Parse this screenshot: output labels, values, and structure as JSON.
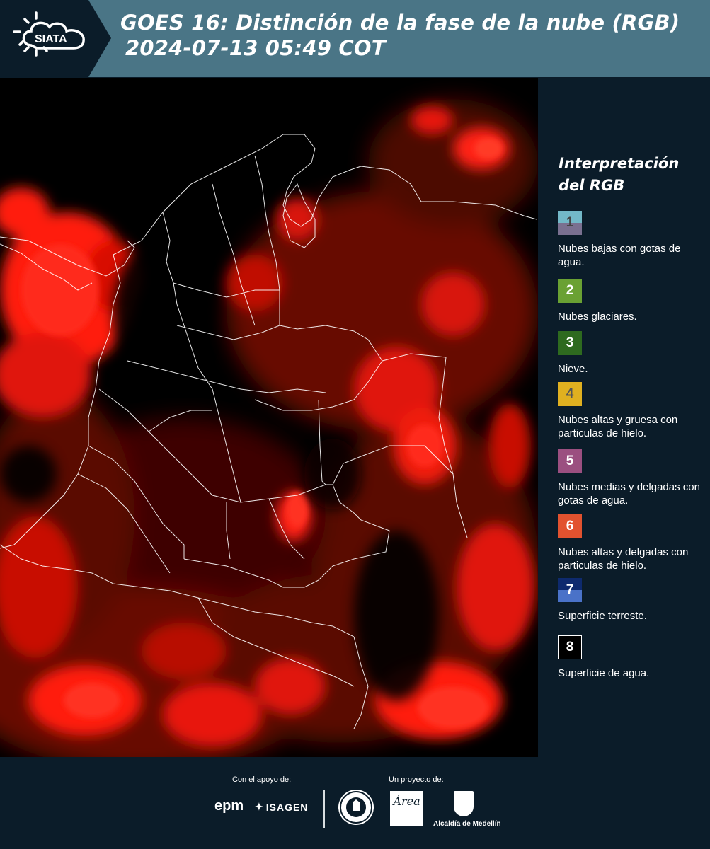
{
  "header": {
    "title_line1": "GOES 16: Distinción de la fase de la nube (RGB)",
    "title_line2": "2024-07-13 05:49 COT",
    "logo_text": "SIATA"
  },
  "legend": {
    "title_line1": "Interpretación",
    "title_line2": "del RGB",
    "items": [
      {
        "num": "1",
        "label": "Nubes bajas con gotas de agua.",
        "color_top": "#73b8c8",
        "color_bottom": "#7a7090",
        "num_color": "#444444"
      },
      {
        "num": "2",
        "label": "Nubes glaciares.",
        "color_top": "#6aa133",
        "color_bottom": "#6aa133",
        "num_color": "#ffffff"
      },
      {
        "num": "3",
        "label": "Nieve.",
        "color_top": "#2e6a1f",
        "color_bottom": "#2e6a1f",
        "num_color": "#ffffff"
      },
      {
        "num": "4",
        "label": "Nubes altas y gruesa con particulas de hielo.",
        "color_top": "#e0b020",
        "color_bottom": "#e0b020",
        "num_color": "#555555"
      },
      {
        "num": "5",
        "label": "Nubes medias y delgadas con gotas de agua.",
        "color_top": "#9b4f80",
        "color_bottom": "#9b4f80",
        "num_color": "#ffffff"
      },
      {
        "num": "6",
        "label": "Nubes altas y delgadas con particulas de hielo.",
        "color_top": "#e2522f",
        "color_bottom": "#e2522f",
        "num_color": "#ffffff"
      },
      {
        "num": "7",
        "label": "Superficie terreste.",
        "color_top": "#0e2a6e",
        "color_bottom": "#4a72c8",
        "num_color": "#ffffff"
      },
      {
        "num": "8",
        "label": "Superficie de agua.",
        "color_top": "#000000",
        "color_bottom": "#000000",
        "num_color": "#ffffff"
      }
    ]
  },
  "footer": {
    "support_label": "Con el apoyo de:",
    "project_label": "Un proyecto de:",
    "epm": "epm",
    "isagen": "ISAGEN",
    "area_text": "Área",
    "medellin": "Alcaldía de Medellín"
  },
  "colors": {
    "header_bg": "#4a7586",
    "page_bg": "#0b1c29",
    "cloud_red": "#ff1a10"
  }
}
